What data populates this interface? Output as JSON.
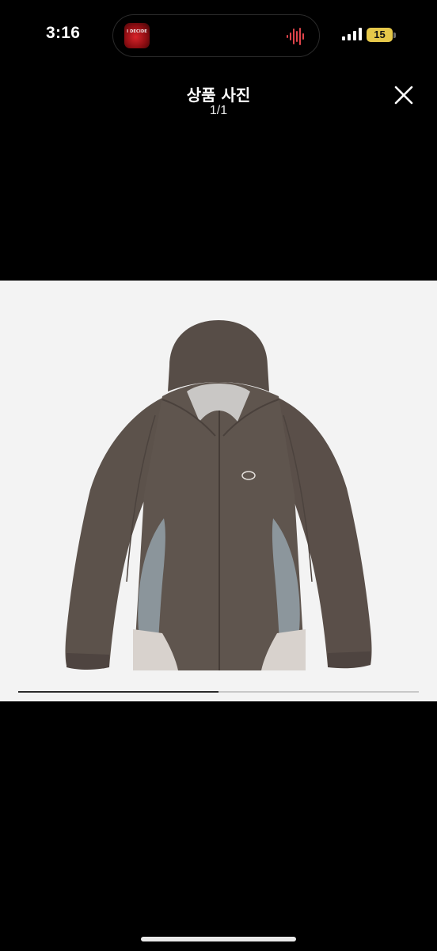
{
  "status_bar": {
    "time": "3:16",
    "battery_level": "15",
    "now_playing_art_text": "I DECIDE"
  },
  "header": {
    "title": "상품 사진",
    "counter": "1/1",
    "close_icon": "close-icon"
  },
  "photo": {
    "subject": "product-photo",
    "scroll_progress": 0.5
  },
  "colors": {
    "background": "#000000",
    "photo_background": "#f3f3f3",
    "battery": "#e6c84a",
    "progress_fill": "#2b2b2b",
    "progress_track": "#c8c8c8"
  }
}
